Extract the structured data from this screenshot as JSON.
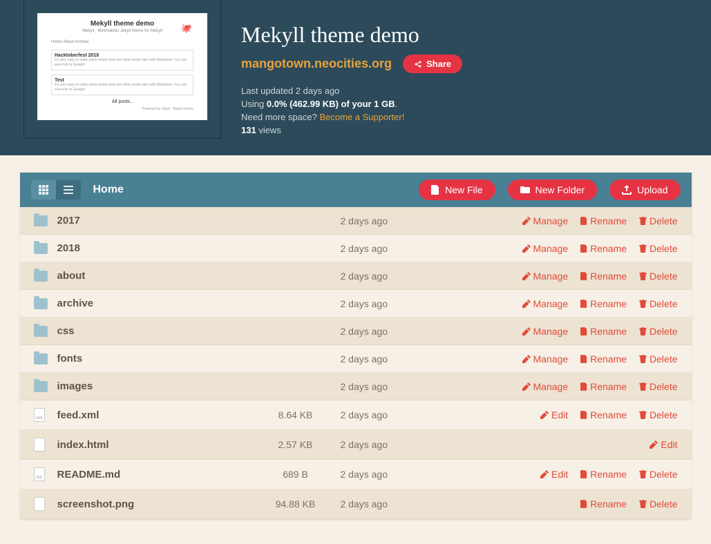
{
  "site": {
    "title": "Mekyll theme demo",
    "url": "mangotown.neocities.org",
    "share_label": "Share",
    "last_updated_prefix": "Last updated ",
    "last_updated": "2 days ago",
    "usage_prefix": "Using ",
    "usage": "0.0% (462.99 KB) of your 1 GB",
    "usage_suffix": ".",
    "space_prompt": "Need more space? ",
    "supporter_link": "Become a Supporter!",
    "views_count": "131",
    "views_label": " views"
  },
  "thumb": {
    "title": "Mekyll theme demo",
    "sub": "Mekyll - Minimalistic Jekyll theme for Mekyll",
    "nav": "Home   About   Archive",
    "box1_title": "Hacktoberfest 2018",
    "box1_text": "It's very easy to make some words bold and other words italic with Markdown. You can even link to Google!",
    "box2_title": "Test",
    "box2_text": "It's very easy to make some words bold and other words italic with Markdown. You can even link to Google!",
    "allposts": "All posts..",
    "footer": "Powered by Jekyll · Mekyll theme"
  },
  "toolbar": {
    "breadcrumb": "Home",
    "new_file": "New File",
    "new_folder": "New Folder",
    "upload": "Upload"
  },
  "actions": {
    "manage": "Manage",
    "rename": "Rename",
    "delete": "Delete",
    "edit": "Edit"
  },
  "files": [
    {
      "type": "folder",
      "name": "2017",
      "size": "",
      "date": "2 days ago",
      "actions": [
        "manage",
        "rename",
        "delete"
      ]
    },
    {
      "type": "folder",
      "name": "2018",
      "size": "",
      "date": "2 days ago",
      "actions": [
        "manage",
        "rename",
        "delete"
      ]
    },
    {
      "type": "folder",
      "name": "about",
      "size": "",
      "date": "2 days ago",
      "actions": [
        "manage",
        "rename",
        "delete"
      ]
    },
    {
      "type": "folder",
      "name": "archive",
      "size": "",
      "date": "2 days ago",
      "actions": [
        "manage",
        "rename",
        "delete"
      ]
    },
    {
      "type": "folder",
      "name": "css",
      "size": "",
      "date": "2 days ago",
      "actions": [
        "manage",
        "rename",
        "delete"
      ]
    },
    {
      "type": "folder",
      "name": "fonts",
      "size": "",
      "date": "2 days ago",
      "actions": [
        "manage",
        "rename",
        "delete"
      ]
    },
    {
      "type": "folder",
      "name": "images",
      "size": "",
      "date": "2 days ago",
      "actions": [
        "manage",
        "rename",
        "delete"
      ]
    },
    {
      "type": "file",
      "ext": "xml",
      "name": "feed.xml",
      "size": "8.64 KB",
      "date": "2 days ago",
      "actions": [
        "edit",
        "rename",
        "delete"
      ]
    },
    {
      "type": "file",
      "ext": "",
      "name": "index.html",
      "size": "2.57 KB",
      "date": "2 days ago",
      "actions": [
        "edit"
      ]
    },
    {
      "type": "file",
      "ext": "md",
      "name": "README.md",
      "size": "689 B",
      "date": "2 days ago",
      "actions": [
        "edit",
        "rename",
        "delete"
      ]
    },
    {
      "type": "file",
      "ext": "",
      "name": "screenshot.png",
      "size": "94.88 KB",
      "date": "2 days ago",
      "actions": [
        "rename",
        "delete"
      ]
    }
  ]
}
